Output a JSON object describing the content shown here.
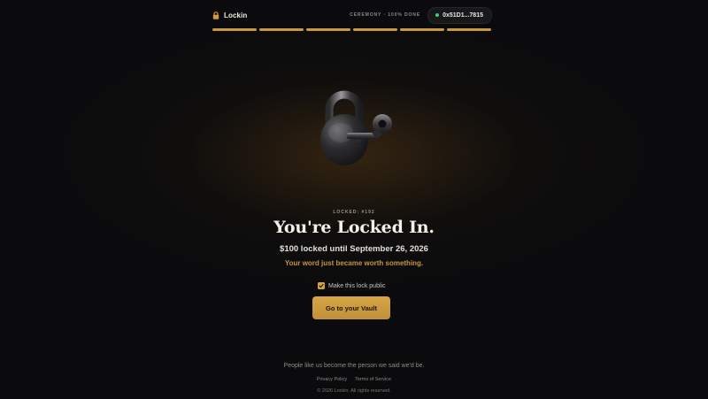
{
  "header": {
    "brand": "Lockin",
    "ceremony_status": "CEREMONY · 100% DONE",
    "wallet_address": "0x51D1...7815"
  },
  "progress": {
    "segments_total": 6,
    "segments_complete": 6,
    "fraction": 1.0
  },
  "main": {
    "lock_id": "LOCKED: #192",
    "title": "You're Locked In.",
    "summary": "$100 locked until September 26, 2026",
    "tagline": "Your word just became worth something.",
    "public_toggle": {
      "label": "Make this lock public",
      "checked": true
    },
    "cta_label": "Go to your Vault"
  },
  "footer": {
    "quote": "People like us become the person we said we'd be.",
    "links": [
      "Privacy Policy",
      "Terms of Service"
    ],
    "copyright": "© 2026 Lockin. All rights reserved."
  },
  "icons": {
    "brand": "lock-icon",
    "wallet": "status-dot-icon",
    "hero": "padlock-with-key-icon",
    "checkbox": "checkmark-icon"
  },
  "colors": {
    "accent": "#c99a3c",
    "background": "#0b0b0d",
    "wallet_status": "#3ecf7f"
  }
}
